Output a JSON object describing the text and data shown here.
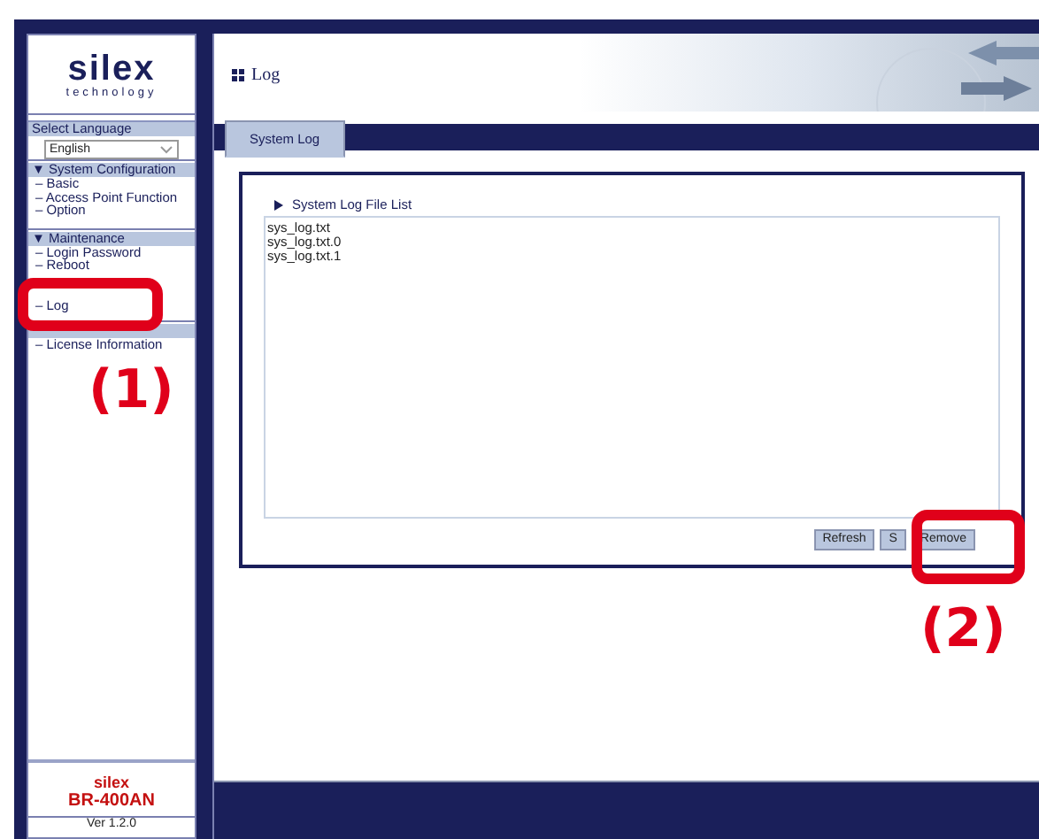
{
  "logo": {
    "brand": "silex",
    "tagline": "technology"
  },
  "language": {
    "label": "Select Language",
    "value": "English"
  },
  "nav": [
    {
      "title": "▼ System Configuration",
      "items": [
        "– Basic",
        "– Access Point Function",
        "– Option"
      ]
    },
    {
      "title": "▼ Maintenance",
      "items": [
        "– Login Password",
        "– Reboot",
        "– Log"
      ]
    },
    {
      "items": [
        "– License Information"
      ]
    }
  ],
  "product": {
    "brand": "silex",
    "model": "BR-400AN",
    "version": "Ver 1.2.0"
  },
  "page": {
    "title": "Log"
  },
  "tabs": [
    {
      "label": "System Log",
      "selected": true
    }
  ],
  "file_list": {
    "title": "System Log File List",
    "files": [
      "sys_log.txt",
      "sys_log.txt.0",
      "sys_log.txt.1"
    ]
  },
  "buttons": [
    "Refresh",
    "S",
    "Remove"
  ],
  "annotations": [
    {
      "label": "(1)"
    },
    {
      "label": "(2)"
    }
  ]
}
